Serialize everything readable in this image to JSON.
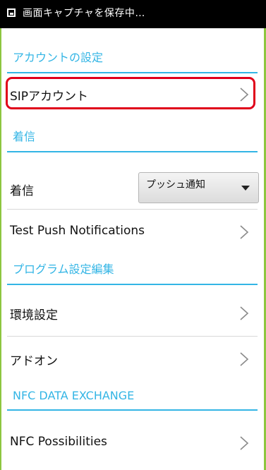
{
  "status_bar": {
    "title": "画面キャプチャを保存中…",
    "icon": "screenshot-icon"
  },
  "sections": {
    "account": {
      "header": "アカウントの設定"
    },
    "incoming": {
      "header": "着信"
    },
    "program": {
      "header": "プログラム設定編集"
    },
    "nfc": {
      "header": "NFC DATA EXCHANGE"
    }
  },
  "rows": {
    "sip_account": {
      "label": "SIPアカウント"
    },
    "incoming": {
      "label": "着信",
      "dropdown_value": "プッシュ通知"
    },
    "test_push": {
      "label": "Test Push Notifications"
    },
    "environment": {
      "label": "環境設定"
    },
    "addons": {
      "label": "アドオン"
    },
    "nfc_possibilities": {
      "label": "NFC Possibilities"
    }
  },
  "colors": {
    "accent": "#33b5e5",
    "highlight": "#e0001a",
    "frame": "#8dc63f"
  },
  "icons": {
    "chevron": "chevron-right-icon",
    "dropdown": "triangle-down-icon"
  }
}
